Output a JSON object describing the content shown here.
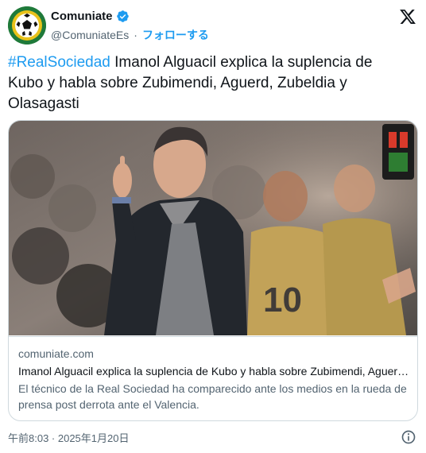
{
  "account": {
    "display_name": "Comuniate",
    "handle": "@ComuniateEs",
    "separator": "·",
    "follow_label": "フォローする",
    "verified": true
  },
  "tweet": {
    "hashtag": "#RealSociedad",
    "text": " Imanol Alguacil explica la suplencia de Kubo y habla sobre Zubimendi, Aguerd, Zubeldia y Olasagasti"
  },
  "card": {
    "domain": "comuniate.com",
    "title": "Imanol Alguacil explica la suplencia de Kubo y habla sobre Zubimendi, Aguerd, Zubeldia y Olasagasti",
    "description": "El técnico de la Real Sociedad ha comparecido ante los medios en la rueda de prensa post derrota ante el Valencia."
  },
  "footer": {
    "timestamp": "午前8:03 · 2025年1月20日"
  },
  "icons": {
    "brand": "x-logo-icon",
    "verified": "verified-badge-icon",
    "info": "info-icon"
  },
  "colors": {
    "link": "#1d9bf0",
    "text": "#0f1419",
    "muted": "#536471",
    "border": "#cfd9de",
    "avatar_bg": "#1f7a3a"
  }
}
